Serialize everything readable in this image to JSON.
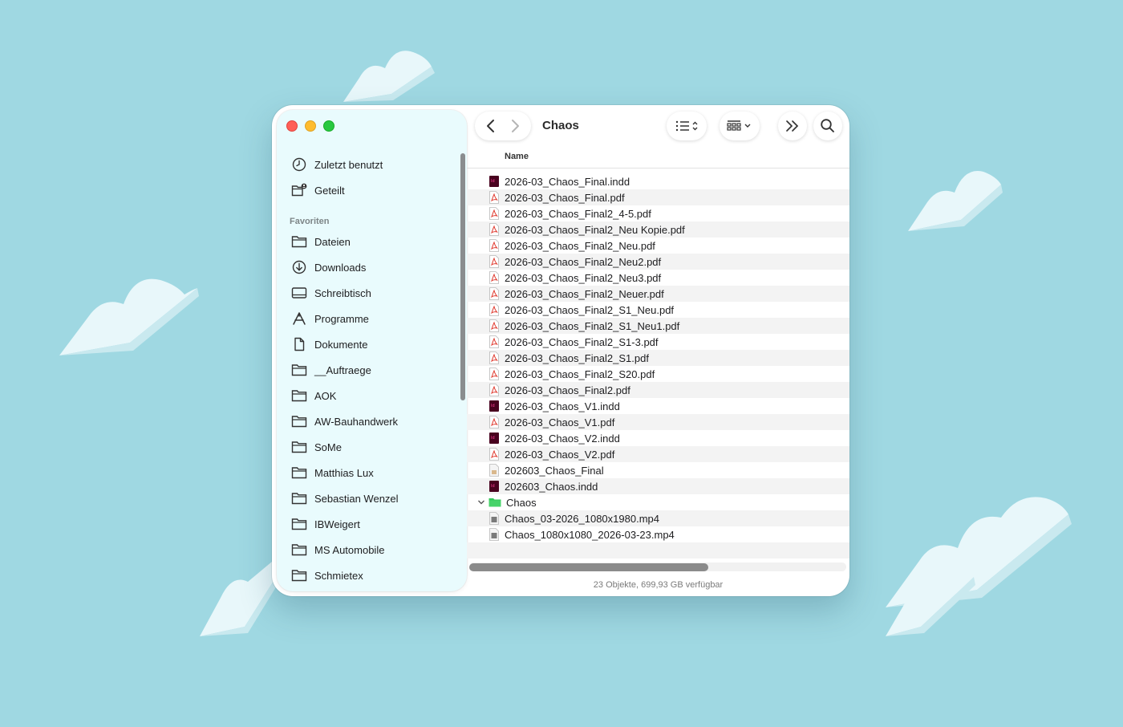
{
  "window": {
    "title": "Chaos"
  },
  "sidebar": {
    "top_items": [
      {
        "label": "Zuletzt benutzt",
        "icon": "clock-icon"
      },
      {
        "label": "Geteilt",
        "icon": "shared-folder-icon"
      }
    ],
    "section_title": "Favoriten",
    "favorites": [
      {
        "label": "Dateien",
        "icon": "folder-icon"
      },
      {
        "label": "Downloads",
        "icon": "download-icon"
      },
      {
        "label": "Schreibtisch",
        "icon": "desktop-icon"
      },
      {
        "label": "Programme",
        "icon": "applications-icon"
      },
      {
        "label": "Dokumente",
        "icon": "document-icon"
      },
      {
        "label": "__Auftraege",
        "icon": "folder-icon"
      },
      {
        "label": "AOK",
        "icon": "folder-icon"
      },
      {
        "label": "AW-Bauhandwerk",
        "icon": "folder-icon"
      },
      {
        "label": "SoMe",
        "icon": "folder-icon"
      },
      {
        "label": "Matthias Lux",
        "icon": "folder-icon"
      },
      {
        "label": "Sebastian Wenzel",
        "icon": "folder-icon"
      },
      {
        "label": "IBWeigert",
        "icon": "folder-icon"
      },
      {
        "label": "MS Automobile",
        "icon": "folder-icon"
      },
      {
        "label": "Schmietex",
        "icon": "folder-icon"
      }
    ]
  },
  "list": {
    "column_header": "Name",
    "files": [
      {
        "name": "2026-03_Chaos_Final.indd",
        "type": "indd"
      },
      {
        "name": "2026-03_Chaos_Final.pdf",
        "type": "pdf"
      },
      {
        "name": "2026-03_Chaos_Final2_4-5.pdf",
        "type": "pdf"
      },
      {
        "name": "2026-03_Chaos_Final2_Neu Kopie.pdf",
        "type": "pdf"
      },
      {
        "name": "2026-03_Chaos_Final2_Neu.pdf",
        "type": "pdf"
      },
      {
        "name": "2026-03_Chaos_Final2_Neu2.pdf",
        "type": "pdf"
      },
      {
        "name": "2026-03_Chaos_Final2_Neu3.pdf",
        "type": "pdf"
      },
      {
        "name": "2026-03_Chaos_Final2_Neuer.pdf",
        "type": "pdf"
      },
      {
        "name": "2026-03_Chaos_Final2_S1_Neu.pdf",
        "type": "pdf"
      },
      {
        "name": "2026-03_Chaos_Final2_S1_Neu1.pdf",
        "type": "pdf"
      },
      {
        "name": "2026-03_Chaos_Final2_S1-3.pdf",
        "type": "pdf"
      },
      {
        "name": "2026-03_Chaos_Final2_S1.pdf",
        "type": "pdf"
      },
      {
        "name": "2026-03_Chaos_Final2_S20.pdf",
        "type": "pdf"
      },
      {
        "name": "2026-03_Chaos_Final2.pdf",
        "type": "pdf"
      },
      {
        "name": "2026-03_Chaos_V1.indd",
        "type": "indd"
      },
      {
        "name": "2026-03_Chaos_V1.pdf",
        "type": "pdf"
      },
      {
        "name": "2026-03_Chaos_V2.indd",
        "type": "indd"
      },
      {
        "name": "2026-03_Chaos_V2.pdf",
        "type": "pdf"
      },
      {
        "name": "202603_Chaos_Final",
        "type": "generic"
      },
      {
        "name": "202603_Chaos.indd",
        "type": "indd"
      },
      {
        "name": "Chaos",
        "type": "folder",
        "expanded": true
      },
      {
        "name": "Chaos_03-2026_1080x1980.mp4",
        "type": "video",
        "indent": true
      },
      {
        "name": "Chaos_1080x1080_2026-03-23.mp4",
        "type": "video",
        "indent": true
      }
    ]
  },
  "status_bar": {
    "text": "23 Objekte, 699,93 GB verfügbar"
  },
  "colors": {
    "background": "#9fd8e2",
    "sidebar": "#e9fbfd",
    "folder_green": "#34c759",
    "pdf_red": "#e03a2f",
    "indd_dark": "#49021f"
  }
}
